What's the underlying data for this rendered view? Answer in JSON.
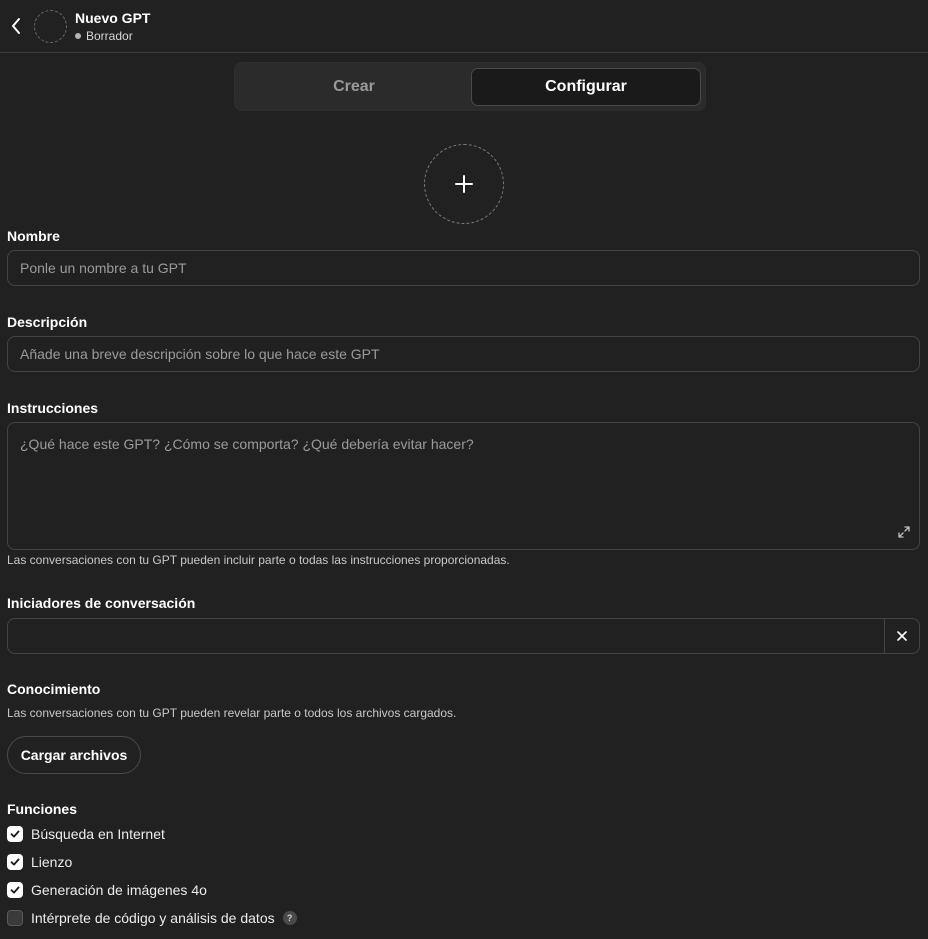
{
  "header": {
    "title": "Nuevo GPT",
    "status": "Borrador"
  },
  "tabs": [
    {
      "label": "Crear",
      "active": false
    },
    {
      "label": "Configurar",
      "active": true
    }
  ],
  "form": {
    "name": {
      "label": "Nombre",
      "placeholder": "Ponle un nombre a tu GPT",
      "value": ""
    },
    "description": {
      "label": "Descripción",
      "placeholder": "Añade una breve descripción sobre lo que hace este GPT",
      "value": ""
    },
    "instructions": {
      "label": "Instrucciones",
      "placeholder": "¿Qué hace este GPT? ¿Cómo se comporta? ¿Qué debería evitar hacer?",
      "value": "",
      "hint": "Las conversaciones con tu GPT pueden incluir parte o todas las instrucciones proporcionadas."
    },
    "starters": {
      "label": "Iniciadores de conversación",
      "value": ""
    },
    "knowledge": {
      "label": "Conocimiento",
      "hint": "Las conversaciones con tu GPT pueden revelar parte o todos los archivos cargados.",
      "upload_label": "Cargar archivos"
    },
    "capabilities": {
      "label": "Funciones",
      "items": [
        {
          "label": "Búsqueda en Internet",
          "checked": true
        },
        {
          "label": "Lienzo",
          "checked": true
        },
        {
          "label": "Generación de imágenes 4o",
          "checked": true
        },
        {
          "label": "Intérprete de código y análisis de datos",
          "checked": false
        }
      ],
      "help_glyph": "?"
    }
  },
  "colors": {
    "background": "#212121",
    "border": "#444444",
    "text": "#ececec",
    "muted": "#9b9b9b"
  }
}
